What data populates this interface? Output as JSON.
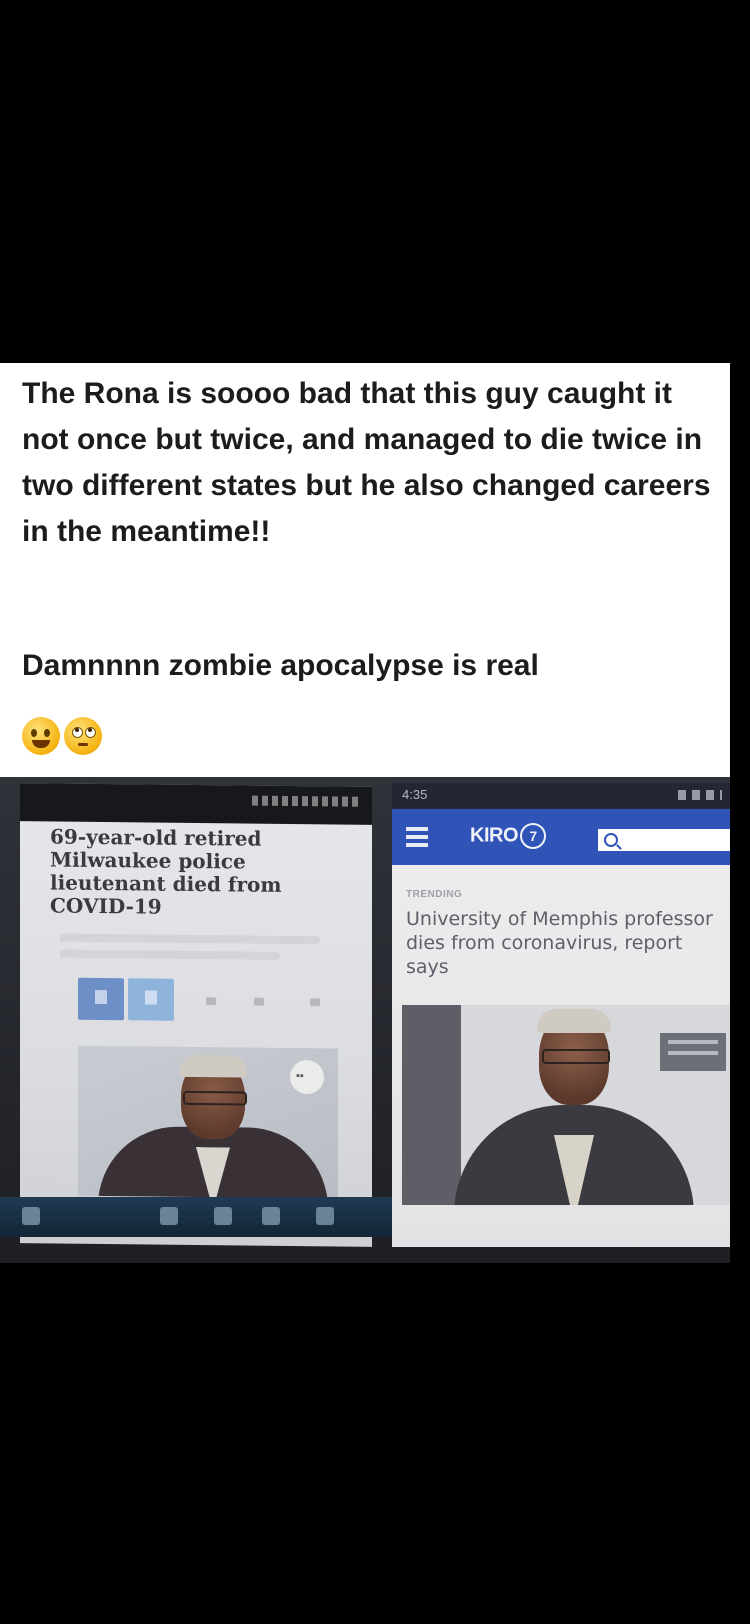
{
  "post": {
    "caption_main": "The Rona is soooo bad that this guy caught it not once but twice, and managed to die twice in two different states but he also changed careers in the meantime!!",
    "caption_secondary": "Damnnnn zombie apocalypse is real",
    "emojis": [
      "rolling-on-floor-laughing-emoji",
      "face-with-rolling-eyes-emoji"
    ]
  },
  "left_article": {
    "headline": "69-year-old retired Milwaukee police lieutenant died from COVID-19",
    "share_buttons": [
      "facebook-icon",
      "twitter-icon"
    ]
  },
  "right_article": {
    "status_time": "4:35",
    "site_logo": "KIRO",
    "site_logo_number": "7",
    "section_label": "TRENDING",
    "headline": "University of Memphis professor dies from coronavirus, report says"
  },
  "colors": {
    "page_background": "#000000",
    "card_background": "#ffffff",
    "caption_text": "#1c1c1c",
    "kiro_nav_blue": "#2f53b6"
  }
}
